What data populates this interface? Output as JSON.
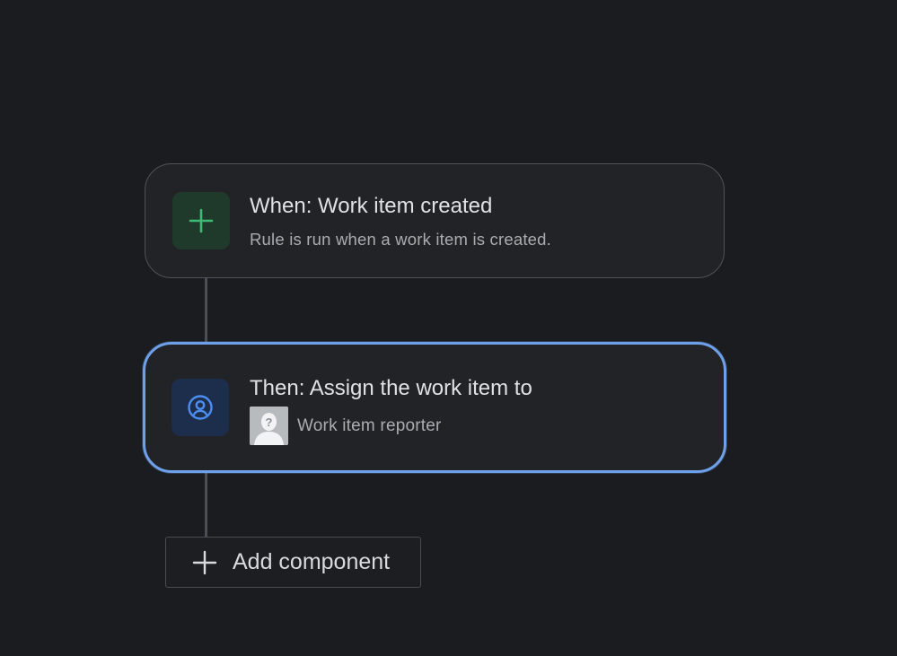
{
  "trigger": {
    "title": "When: Work item created",
    "subtitle": "Rule is run when a work item is created.",
    "icon": "plus-icon",
    "accent_color": "#3fba75"
  },
  "action": {
    "title": "Then: Assign the work item to",
    "assignee_label": "Work item reporter",
    "icon": "user-circle-icon",
    "accent_color": "#4b8ef0",
    "selected_border_color": "#6fa0ea"
  },
  "add_component": {
    "label": "Add component",
    "icon": "plus-icon"
  }
}
